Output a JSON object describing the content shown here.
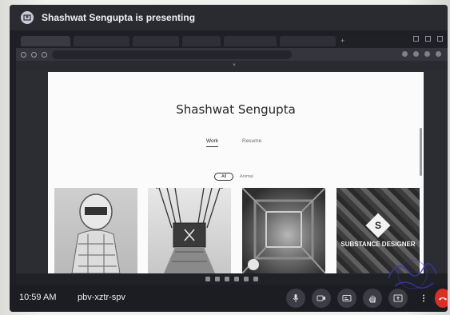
{
  "meet": {
    "presenting_banner": "Shashwat Sengupta is presenting",
    "time": "10:59 AM",
    "meeting_code": "pbv-xztr-spv"
  },
  "browser": {
    "tabs": [
      "",
      "",
      "",
      "",
      "",
      ""
    ],
    "url": "",
    "sharing_bar_text": ""
  },
  "portfolio": {
    "name": "Shashwat Sengupta",
    "tagline": "",
    "tabs": {
      "work": "Work",
      "resume": "Resume"
    },
    "filters": {
      "all": "All",
      "animal": "Animal"
    },
    "thumb4_text": "SUBSTANCE DESIGNER"
  },
  "icons": [
    "present-icon",
    "mic-icon",
    "camera-icon",
    "captions-icon",
    "hand-icon",
    "present-now-icon",
    "more-icon",
    "end-call-icon"
  ]
}
